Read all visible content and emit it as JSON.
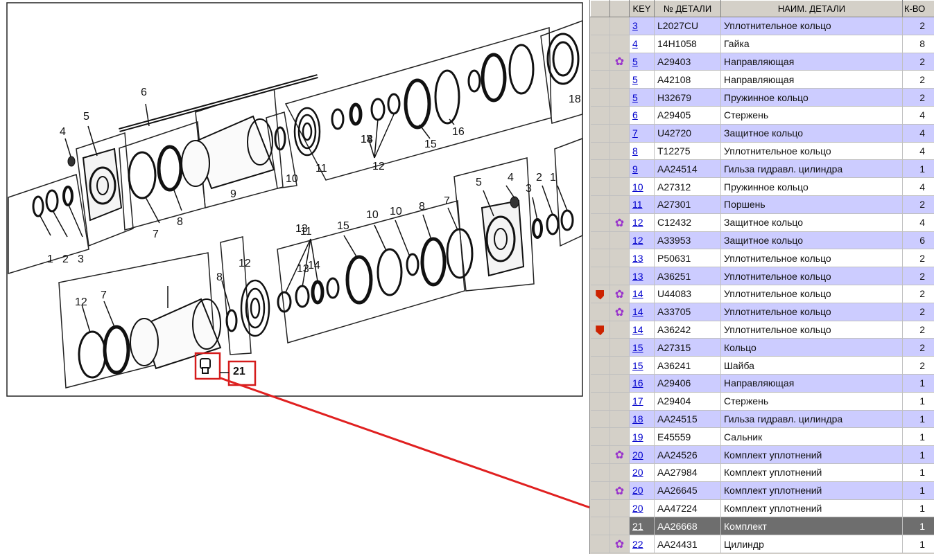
{
  "diagram": {
    "callout_label": "21",
    "callouts": [
      "1",
      "2",
      "3",
      "4",
      "5",
      "6",
      "7",
      "8",
      "9",
      "10",
      "11",
      "12",
      "13",
      "2",
      "1",
      "3",
      "4",
      "5",
      "7",
      "8",
      "10",
      "11",
      "12",
      "13",
      "14",
      "15",
      "10",
      "8",
      "7",
      "12",
      "13",
      "14",
      "15",
      "16",
      "18"
    ]
  },
  "table": {
    "headers": {
      "key": "KEY",
      "part_no": "№ ДЕТАЛИ",
      "name": "НАИМ. ДЕТАЛИ",
      "qty": "К-ВО"
    },
    "rows": [
      {
        "key": "3",
        "part_no": "L2027CU",
        "name": "Уплотнительное кольцо",
        "qty": "2",
        "icon": "",
        "flag": false,
        "style": "alt"
      },
      {
        "key": "4",
        "part_no": "14H1058",
        "name": "Гайка",
        "qty": "8",
        "icon": "",
        "flag": false,
        "style": "plain"
      },
      {
        "key": "5",
        "part_no": "A29403",
        "name": "Направляющая",
        "qty": "2",
        "icon": "gear",
        "flag": false,
        "style": "alt"
      },
      {
        "key": "5",
        "part_no": "A42108",
        "name": "Направляющая",
        "qty": "2",
        "icon": "",
        "flag": false,
        "style": "plain"
      },
      {
        "key": "5",
        "part_no": "H32679",
        "name": "Пружинное кольцо",
        "qty": "2",
        "icon": "",
        "flag": false,
        "style": "alt"
      },
      {
        "key": "6",
        "part_no": "A29405",
        "name": "Стержень",
        "qty": "4",
        "icon": "",
        "flag": false,
        "style": "plain"
      },
      {
        "key": "7",
        "part_no": "U42720",
        "name": "Защитное кольцо",
        "qty": "4",
        "icon": "",
        "flag": false,
        "style": "alt"
      },
      {
        "key": "8",
        "part_no": "T12275",
        "name": "Уплотнительное кольцо",
        "qty": "4",
        "icon": "",
        "flag": false,
        "style": "plain"
      },
      {
        "key": "9",
        "part_no": "AA24514",
        "name": "Гильза гидравл. цилиндра",
        "qty": "1",
        "icon": "",
        "flag": false,
        "style": "alt"
      },
      {
        "key": "10",
        "part_no": "A27312",
        "name": "Пружинное кольцо",
        "qty": "4",
        "icon": "",
        "flag": false,
        "style": "plain"
      },
      {
        "key": "11",
        "part_no": "A27301",
        "name": "Поршень",
        "qty": "2",
        "icon": "",
        "flag": false,
        "style": "alt"
      },
      {
        "key": "12",
        "part_no": "C12432",
        "name": "Защитное кольцо",
        "qty": "4",
        "icon": "gear",
        "flag": false,
        "style": "plain"
      },
      {
        "key": "12",
        "part_no": "A33953",
        "name": "Защитное кольцо",
        "qty": "6",
        "icon": "",
        "flag": false,
        "style": "alt"
      },
      {
        "key": "13",
        "part_no": "P50631",
        "name": "Уплотнительное кольцо",
        "qty": "2",
        "icon": "",
        "flag": false,
        "style": "plain"
      },
      {
        "key": "13",
        "part_no": "A36251",
        "name": "Уплотнительное кольцо",
        "qty": "2",
        "icon": "",
        "flag": false,
        "style": "alt"
      },
      {
        "key": "14",
        "part_no": "U44083",
        "name": "Уплотнительное кольцо",
        "qty": "2",
        "icon": "gear",
        "flag": true,
        "style": "plain"
      },
      {
        "key": "14",
        "part_no": "A33705",
        "name": "Уплотнительное кольцо",
        "qty": "2",
        "icon": "gear",
        "flag": false,
        "style": "alt"
      },
      {
        "key": "14",
        "part_no": "A36242",
        "name": "Уплотнительное кольцо",
        "qty": "2",
        "icon": "",
        "flag": true,
        "style": "plain"
      },
      {
        "key": "15",
        "part_no": "A27315",
        "name": "Кольцо",
        "qty": "2",
        "icon": "",
        "flag": false,
        "style": "alt"
      },
      {
        "key": "15",
        "part_no": "A36241",
        "name": "Шайба",
        "qty": "2",
        "icon": "",
        "flag": false,
        "style": "plain"
      },
      {
        "key": "16",
        "part_no": "A29406",
        "name": "Направляющая",
        "qty": "1",
        "icon": "",
        "flag": false,
        "style": "alt"
      },
      {
        "key": "17",
        "part_no": "A29404",
        "name": "Стержень",
        "qty": "1",
        "icon": "",
        "flag": false,
        "style": "plain"
      },
      {
        "key": "18",
        "part_no": "AA24515",
        "name": "Гильза гидравл. цилиндра",
        "qty": "1",
        "icon": "",
        "flag": false,
        "style": "alt"
      },
      {
        "key": "19",
        "part_no": "E45559",
        "name": "Сальник",
        "qty": "1",
        "icon": "",
        "flag": false,
        "style": "plain"
      },
      {
        "key": "20",
        "part_no": "AA24526",
        "name": "Комплект уплотнений",
        "qty": "1",
        "icon": "gear",
        "flag": false,
        "style": "alt"
      },
      {
        "key": "20",
        "part_no": "AA27984",
        "name": "Комплект уплотнений",
        "qty": "1",
        "icon": "",
        "flag": false,
        "style": "plain"
      },
      {
        "key": "20",
        "part_no": "AA26645",
        "name": "Комплект уплотнений",
        "qty": "1",
        "icon": "gear",
        "flag": false,
        "style": "alt"
      },
      {
        "key": "20",
        "part_no": "AA47224",
        "name": "Комплект уплотнений",
        "qty": "1",
        "icon": "",
        "flag": false,
        "style": "plain"
      },
      {
        "key": "21",
        "part_no": "AA26668",
        "name": "Комплект",
        "qty": "1",
        "icon": "",
        "flag": false,
        "style": "sel"
      },
      {
        "key": "22",
        "part_no": "AA24431",
        "name": "Цилиндр",
        "qty": "1",
        "icon": "gear",
        "flag": false,
        "style": "plain"
      }
    ]
  },
  "colors": {
    "row_alt": "#ccccff",
    "selected": "#6e6e6e",
    "arrow": "#e02020",
    "gear": "#9933cc",
    "flag": "#cc2200"
  }
}
